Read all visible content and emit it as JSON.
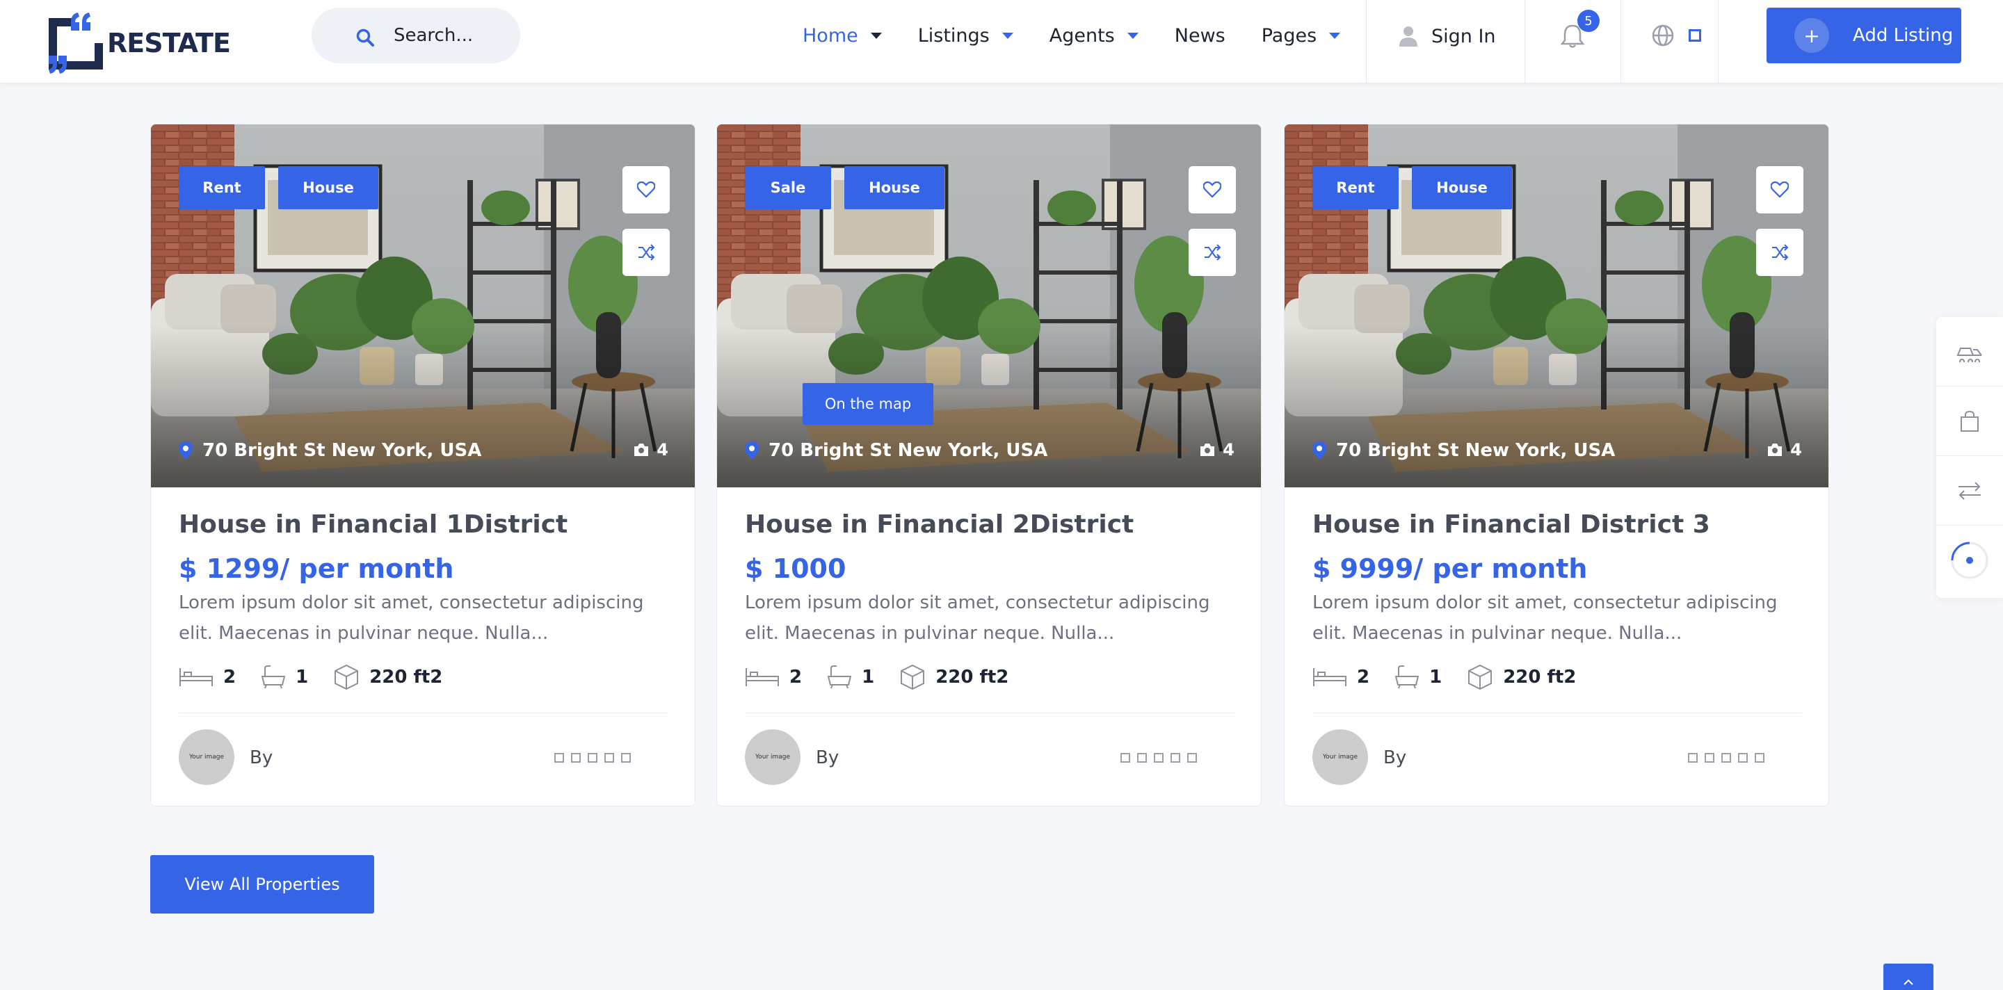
{
  "header": {
    "logo_text": "RESTATE",
    "search_placeholder": "Search...",
    "nav": [
      {
        "label": "Home",
        "active": true,
        "dropdown": true
      },
      {
        "label": "Listings",
        "active": false,
        "dropdown": true
      },
      {
        "label": "Agents",
        "active": false,
        "dropdown": true
      },
      {
        "label": "News",
        "active": false,
        "dropdown": false
      },
      {
        "label": "Pages",
        "active": false,
        "dropdown": true
      }
    ],
    "sign_in": "Sign In",
    "notification_count": "5",
    "add_listing": "Add Listing",
    "add_listing_icon": "+"
  },
  "listings": [
    {
      "tags": [
        "Rent",
        "House"
      ],
      "address": "70 Bright St New York, USA",
      "photo_count": "4",
      "title": "House in Financial 1District",
      "price": "$ 1299/ per month",
      "description": "Lorem ipsum dolor sit amet, consectetur adipiscing elit. Maecenas in pulvinar neque. Nulla...",
      "beds": "2",
      "baths": "1",
      "area": "220 ft2",
      "avatar_text": "Your image",
      "by_label": "By"
    },
    {
      "tags": [
        "Sale",
        "House"
      ],
      "address": "70 Bright St New York, USA",
      "photo_count": "4",
      "map_button": "On the map",
      "title": "House in Financial 2District",
      "price": "$ 1000",
      "description": "Lorem ipsum dolor sit amet, consectetur adipiscing elit. Maecenas in pulvinar neque. Nulla...",
      "beds": "2",
      "baths": "1",
      "area": "220 ft2",
      "avatar_text": "Your image",
      "by_label": "By"
    },
    {
      "tags": [
        "Rent",
        "House"
      ],
      "address": "70 Bright St New York, USA",
      "photo_count": "4",
      "title": "House in Financial District 3",
      "price": "$ 9999/ per month",
      "description": "Lorem ipsum dolor sit amet, consectetur adipiscing elit. Maecenas in pulvinar neque. Nulla...",
      "beds": "2",
      "baths": "1",
      "area": "220 ft2",
      "avatar_text": "Your image",
      "by_label": "By"
    }
  ],
  "view_all": "View All Properties",
  "colors": {
    "accent": "#3565e6",
    "text": "#1d2433",
    "muted": "#6b7180",
    "background": "#f6f7fa"
  },
  "icons": {
    "side_panel": [
      "car-compare-icon",
      "shopping-bag-icon",
      "arrows-swap-icon",
      "spinner-icon"
    ],
    "card_actions": [
      "heart-icon",
      "shuffle-icon"
    ]
  }
}
